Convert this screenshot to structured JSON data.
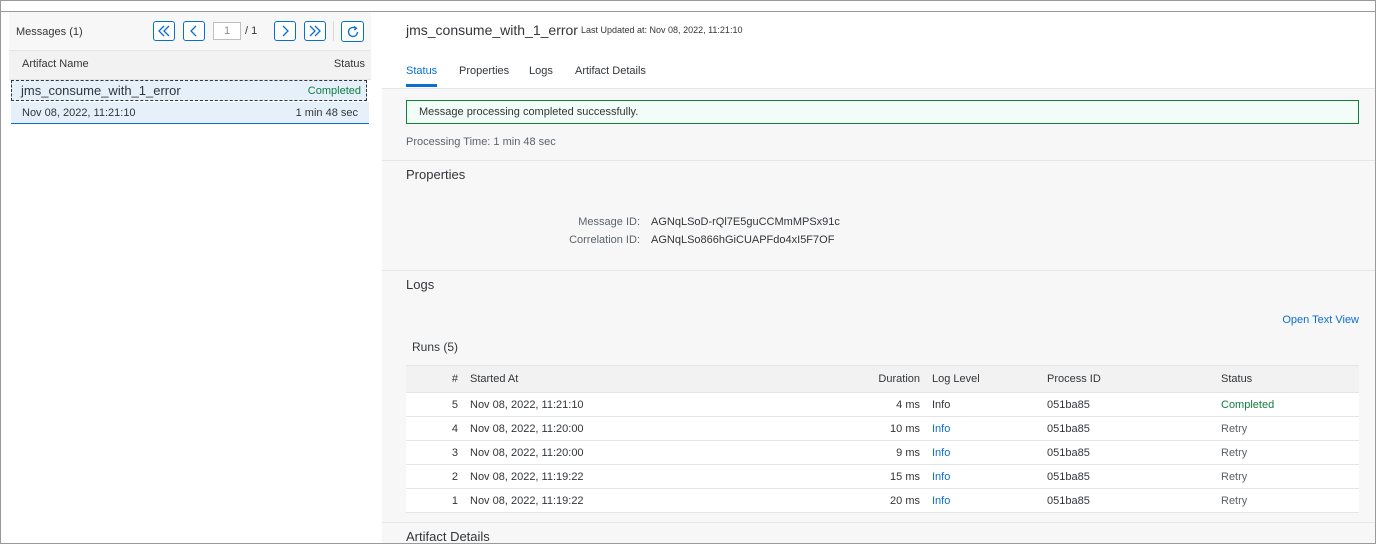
{
  "left": {
    "messages_label": "Messages (1)",
    "pager": {
      "first_icon": "double-chevron-left-icon",
      "prev_icon": "chevron-left-icon",
      "current_page": "1",
      "total_pages": "/ 1",
      "next_icon": "chevron-right-icon",
      "last_icon": "double-chevron-right-icon"
    },
    "refresh_icon": "refresh-icon",
    "columns": {
      "name": "Artifact Name",
      "status": "Status"
    },
    "selected_item": {
      "name": "jms_consume_with_1_error",
      "status": "Completed",
      "date": "Nov 08, 2022, 11:21:10",
      "duration": "1 min 48 sec"
    }
  },
  "detail": {
    "title": "jms_consume_with_1_error",
    "last_updated": "Last Updated at: Nov 08, 2022, 11:21:10",
    "tabs": [
      {
        "label": "Status"
      },
      {
        "label": "Properties"
      },
      {
        "label": "Logs"
      },
      {
        "label": "Artifact Details"
      }
    ],
    "banner": "Message processing completed successfully.",
    "processing_time": "Processing Time: 1 min 48 sec",
    "properties": {
      "title": "Properties",
      "message_id_label": "Message ID:",
      "message_id": "AGNqLSoD-rQl7E5guCCMmMPSx91c",
      "correlation_id_label": "Correlation ID:",
      "correlation_id": "AGNqLSo866hGiCUAPFdo4xI5F7OF"
    },
    "logs": {
      "title": "Logs",
      "open_text_view": "Open Text View",
      "runs_title": "Runs (5)",
      "columns": {
        "num": "#",
        "started_at": "Started At",
        "duration": "Duration",
        "log_level": "Log Level",
        "process_id": "Process ID",
        "status": "Status"
      },
      "rows": [
        {
          "num": "5",
          "started_at": "Nov 08, 2022, 11:21:10",
          "duration": "4 ms",
          "log_level": "Info",
          "process_id": "051ba85",
          "status": "Completed"
        },
        {
          "num": "4",
          "started_at": "Nov 08, 2022, 11:20:00",
          "duration": "10 ms",
          "log_level": "Info",
          "process_id": "051ba85",
          "status": "Retry"
        },
        {
          "num": "3",
          "started_at": "Nov 08, 2022, 11:20:00",
          "duration": "9 ms",
          "log_level": "Info",
          "process_id": "051ba85",
          "status": "Retry"
        },
        {
          "num": "2",
          "started_at": "Nov 08, 2022, 11:19:22",
          "duration": "15 ms",
          "log_level": "Info",
          "process_id": "051ba85",
          "status": "Retry"
        },
        {
          "num": "1",
          "started_at": "Nov 08, 2022, 11:19:22",
          "duration": "20 ms",
          "log_level": "Info",
          "process_id": "051ba85",
          "status": "Retry"
        }
      ]
    },
    "artifact_details_title": "Artifact Details"
  },
  "colors": {
    "accent": "#0a6ed1",
    "success": "#107e3e"
  }
}
